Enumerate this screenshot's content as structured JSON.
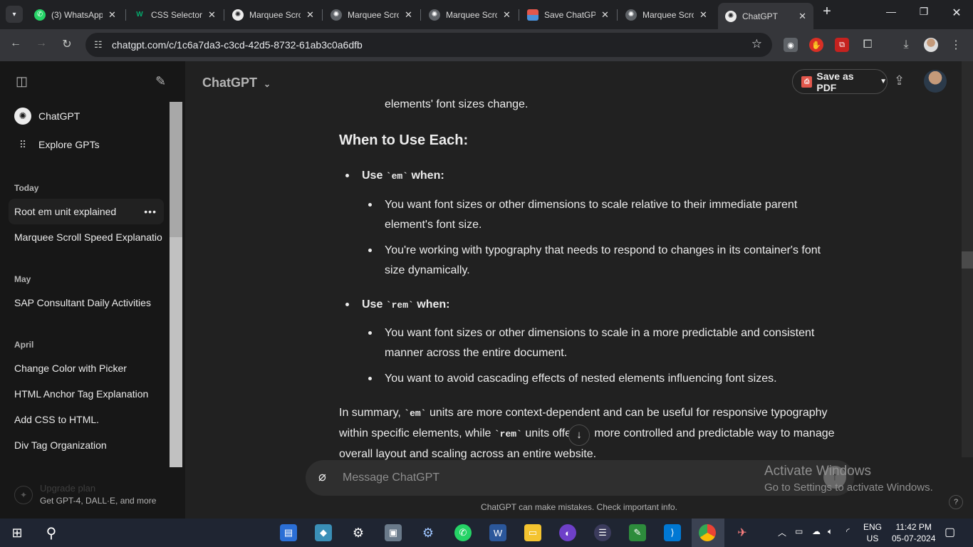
{
  "browser": {
    "tabs": [
      {
        "title": "(3) WhatsApp",
        "icon": "whatsapp-icon"
      },
      {
        "title": "CSS Selectors",
        "icon": "w3schools-icon"
      },
      {
        "title": "Marquee Scroll",
        "icon": "chatgpt-icon"
      },
      {
        "title": "Marquee Scroll",
        "icon": "chatgpt-icon"
      },
      {
        "title": "Marquee Scroll",
        "icon": "chatgpt-icon"
      },
      {
        "title": "Save ChatGPT",
        "icon": "pdf-extension-icon"
      },
      {
        "title": "Marquee Scroll",
        "icon": "chatgpt-icon"
      },
      {
        "title": "ChatGPT",
        "icon": "chatgpt-icon"
      }
    ],
    "new_tab": "+",
    "url": "chatgpt.com/c/1c6a7da3-c3cd-42d5-8732-61ab3c0a6dfb"
  },
  "sidebar": {
    "items": [
      {
        "label": "ChatGPT",
        "icon": "chatgpt-logo-icon"
      },
      {
        "label": "Explore GPTs",
        "icon": "grid-icon"
      }
    ],
    "sections": [
      {
        "heading": "Today",
        "chats": [
          "Root em unit explained",
          "Marquee Scroll Speed Explanatio"
        ]
      },
      {
        "heading": "May",
        "chats": [
          "SAP Consultant Daily Activities"
        ]
      },
      {
        "heading": "April",
        "chats": [
          "Change Color with Picker",
          "HTML Anchor Tag Explanation",
          "Add CSS to HTML.",
          "Div Tag Organization"
        ]
      }
    ],
    "more": "•••",
    "upgrade": {
      "title": "Upgrade plan",
      "subtitle": "Get GPT-4, DALL·E, and more"
    }
  },
  "header": {
    "model": "ChatGPT",
    "save_pdf": "Save as PDF"
  },
  "content": {
    "partial_line": "elements' font sizes change.",
    "heading": "When to Use Each:",
    "em_prefix": "Use ",
    "em_code": "`em`",
    "em_suffix": " when:",
    "em_points": [
      [
        "You want font sizes or other dimensions to scale relative to their immediate parent",
        "element's font size."
      ],
      [
        "You're working with typography that needs to respond to changes in its container's font",
        "size dynamically."
      ]
    ],
    "rem_prefix": "Use ",
    "rem_code": "`rem`",
    "rem_suffix": " when:",
    "rem_points": [
      [
        "You want font sizes or other dimensions to scale in a more predictable and consistent",
        "manner across the entire document."
      ],
      [
        "You want to avoid cascading effects of nested elements influencing font sizes.",
        ""
      ]
    ],
    "summary": {
      "a": "In summary, ",
      "em": "`em`",
      "b": " units are more context-dependent and can be useful for responsive typography",
      "c": "within specific elements, while ",
      "rem": "`rem`",
      "d": " units offe",
      "e": " more controlled and predictable way to manage",
      "f": "overall layout and scaling across an entire website."
    }
  },
  "composer": {
    "placeholder": "Message ChatGPT"
  },
  "disclaimer": "ChatGPT can make mistakes. Check important info.",
  "help": "?",
  "watermark": {
    "line1": "Activate Windows",
    "line2": "Go to Settings to activate Windows."
  },
  "taskbar": {
    "lang": "ENG",
    "region": "US",
    "time": "11:42 PM",
    "date": "05-07-2024"
  }
}
